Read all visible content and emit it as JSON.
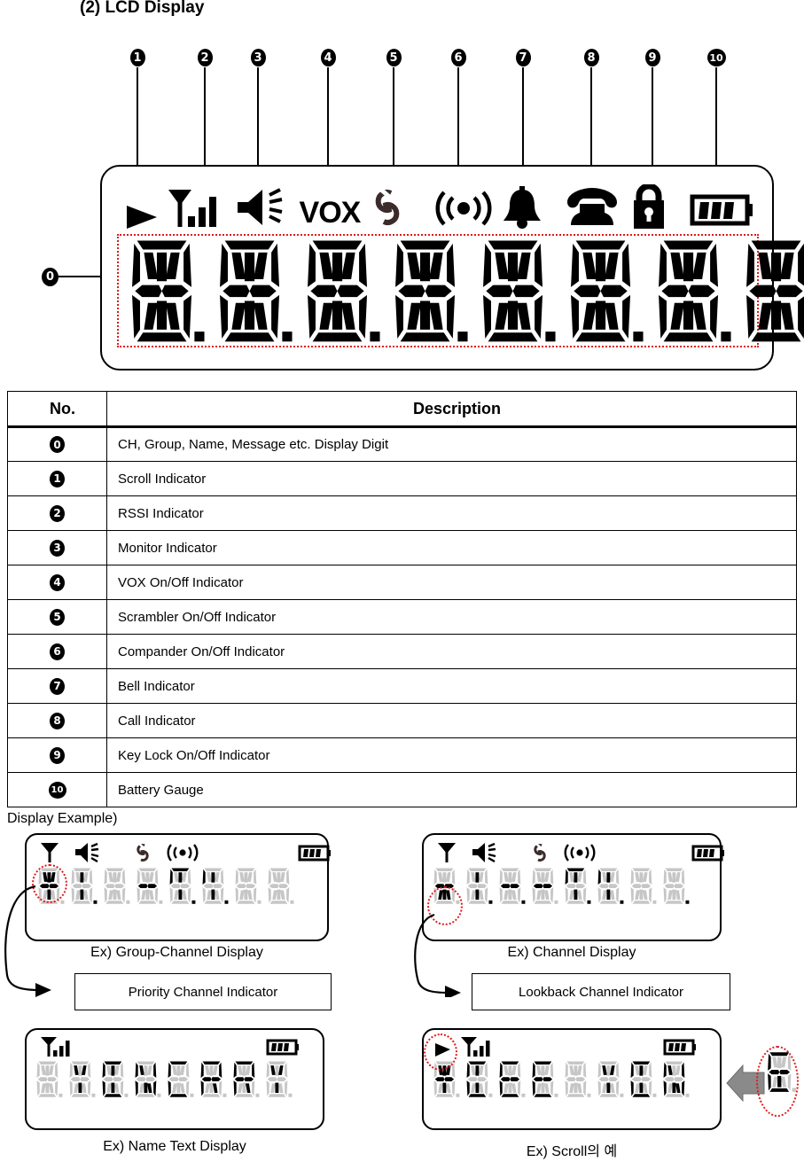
{
  "heading": "(2) LCD Display",
  "diagram": {
    "markers": [
      "1",
      "2",
      "3",
      "4",
      "5",
      "6",
      "7",
      "8",
      "9",
      "10"
    ],
    "digit_marker": "0",
    "icons": [
      {
        "name": "scroll-indicator-icon",
        "label": "Scroll Indicator"
      },
      {
        "name": "rssi-indicator-icon",
        "label": "RSSI Indicator"
      },
      {
        "name": "monitor-speaker-icon",
        "label": "Monitor Indicator"
      },
      {
        "name": "vox-icon",
        "label": "VOX"
      },
      {
        "name": "scrambler-icon",
        "label": "Scrambler Indicator"
      },
      {
        "name": "compander-icon",
        "label": "Compander Indicator"
      },
      {
        "name": "bell-icon",
        "label": "Bell Indicator"
      },
      {
        "name": "call-phone-icon",
        "label": "Call Indicator"
      },
      {
        "name": "key-lock-icon",
        "label": "Key Lock Indicator"
      },
      {
        "name": "battery-gauge-icon",
        "label": "Battery Gauge"
      }
    ],
    "vox_text": "VOX",
    "digit_count": 8
  },
  "table": {
    "headers": {
      "no": "No.",
      "description": "Description"
    },
    "rows": [
      {
        "no": "0",
        "description": "CH, Group, Name, Message etc. Display Digit"
      },
      {
        "no": "1",
        "description": "Scroll Indicator"
      },
      {
        "no": "2",
        "description": "RSSI Indicator"
      },
      {
        "no": "3",
        "description": "Monitor Indicator"
      },
      {
        "no": "4",
        "description": "VOX On/Off Indicator"
      },
      {
        "no": "5",
        "description": "Scrambler On/Off Indicator"
      },
      {
        "no": "6",
        "description": "Compander On/Off Indicator"
      },
      {
        "no": "7",
        "description": "Bell Indicator"
      },
      {
        "no": "8",
        "description": "Call Indicator"
      },
      {
        "no": "9",
        "description": "Key Lock On/Off Indicator"
      },
      {
        "no": "10",
        "description": "Battery Gauge"
      }
    ]
  },
  "examples": {
    "section_title": "Display Example)",
    "group_channel": {
      "caption": "Ex) Group-Channel Display",
      "callout": "Priority Channel Indicator",
      "icons": [
        "antenna-icon",
        "monitor-speaker-icon",
        "scrambler-icon",
        "compander-icon",
        "battery-gauge-icon"
      ]
    },
    "channel": {
      "caption": "Ex) Channel Display",
      "callout": "Lookback Channel Indicator",
      "icons": [
        "antenna-icon",
        "monitor-speaker-icon",
        "scrambler-icon",
        "compander-icon",
        "battery-gauge-icon"
      ]
    },
    "name_text": {
      "caption": "Ex) Name Text Display",
      "icons": [
        "rssi-indicator-icon",
        "battery-gauge-icon"
      ]
    },
    "scroll": {
      "caption": "Ex) Scroll의  예",
      "icons": [
        "scroll-indicator-icon",
        "rssi-indicator-icon",
        "battery-gauge-icon"
      ]
    }
  },
  "colors": {
    "ink": "#000000",
    "highlight": "#e01b1b",
    "segment_off": "#c6c6c6",
    "arrow_gray": "#8a8a8a"
  }
}
